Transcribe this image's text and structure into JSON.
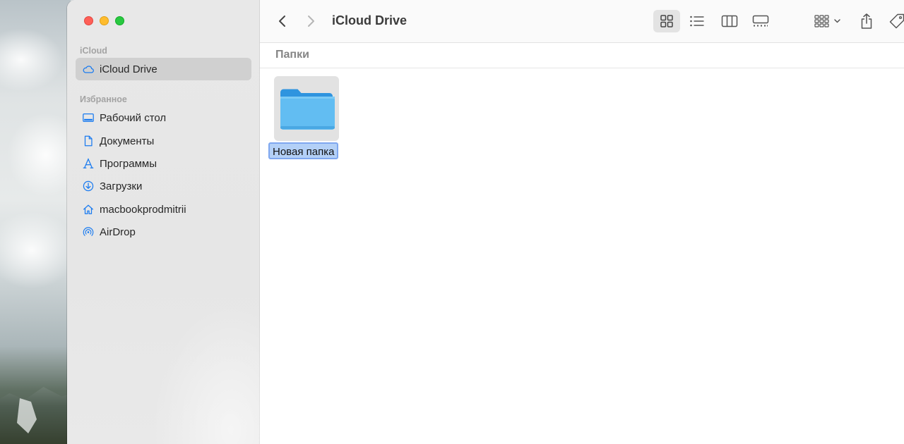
{
  "window": {
    "controls": [
      "close",
      "minimize",
      "zoom"
    ]
  },
  "sidebar": {
    "sections": [
      {
        "title": "iCloud",
        "items": [
          {
            "label": "iCloud Drive",
            "icon": "cloud-icon",
            "selected": true
          }
        ]
      },
      {
        "title": "Избранное",
        "items": [
          {
            "label": "Рабочий стол",
            "icon": "desktop-icon"
          },
          {
            "label": "Документы",
            "icon": "document-icon"
          },
          {
            "label": "Программы",
            "icon": "applications-icon"
          },
          {
            "label": "Загрузки",
            "icon": "download-icon"
          },
          {
            "label": "macbookprodmitrii",
            "icon": "home-icon"
          },
          {
            "label": "AirDrop",
            "icon": "airdrop-icon"
          }
        ]
      }
    ]
  },
  "toolbar": {
    "title": "iCloud Drive",
    "buttons": [
      "back-icon",
      "forward-icon",
      "icon-view-icon",
      "list-view-icon",
      "column-view-icon",
      "gallery-view-icon",
      "group-by-icon",
      "share-icon",
      "tag-icon",
      "more-icon"
    ],
    "active_view": "icon-view"
  },
  "content": {
    "group_title": "Папки",
    "items": [
      {
        "name": "Новая папка",
        "type": "folder",
        "selected": true,
        "renaming": true
      }
    ]
  },
  "colors": {
    "accent": "#1a7bf0",
    "selection_label": "#b3d0f7",
    "folder": "#5cb7ef"
  }
}
